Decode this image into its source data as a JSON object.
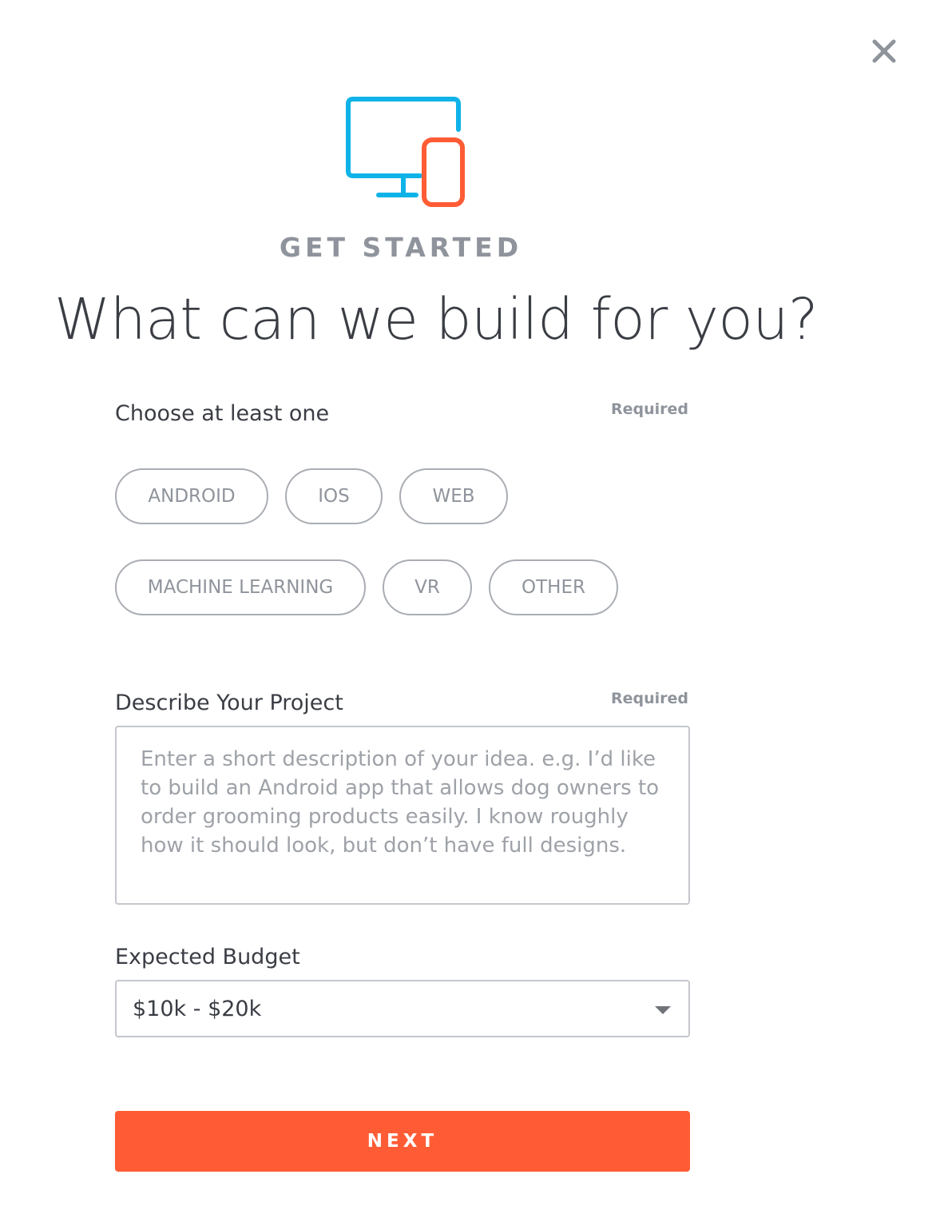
{
  "close": {
    "icon": "close-icon"
  },
  "hero": {
    "icon": "desktop-and-phone-icon",
    "monitor_color": "#10b3e8",
    "phone_color": "#ff5c35"
  },
  "eyebrow": "GET STARTED",
  "headline": "What can we build for you?",
  "platforms": {
    "label": "Choose at least one",
    "required": "Required",
    "row1": [
      "ANDROID",
      "IOS",
      "WEB"
    ],
    "row2": [
      "MACHINE LEARNING",
      "VR",
      "OTHER"
    ]
  },
  "project": {
    "label": "Describe Your Project",
    "required": "Required",
    "placeholder": "Enter a short description of your idea. e.g. I’d like to build an Android app that allows dog owners to order grooming products easily. I know roughly how it should look, but don’t have full designs."
  },
  "budget": {
    "label": "Expected Budget",
    "value": "$10k - $20k",
    "icon": "chevron-down-icon"
  },
  "next_button": {
    "label": "NEXT",
    "color": "#ff5c35"
  }
}
